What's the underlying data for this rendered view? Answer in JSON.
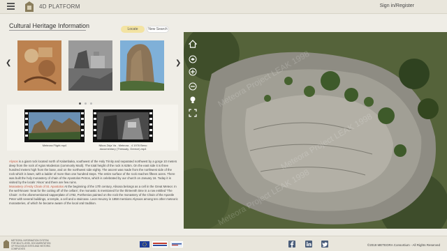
{
  "header": {
    "brand": "4D PLATFORM",
    "signin": "Sign in/Register"
  },
  "panel": {
    "title": "Cultural Heritage Information",
    "locate_label": "Locate",
    "new_search_label": "New Search"
  },
  "videos": [
    {
      "caption": "Meteora Flight.mp4"
    },
    {
      "caption": "Nikos Zeja Va - Meteora - 4 1976 Beno documentary (Thessaly, Greece).mp4"
    }
  ],
  "description": {
    "p1_name": "Alysos",
    "p1_text": " is a giant rock located north of Kalambaka, southwest of the Holy Trinity and separated northwest by a gorge 10 meters deep from the rock of Agios Modestos (commonly Modi). The total height of the rock is 625m. On the east side it is three hundred meters high from the base, and on the northwest side eighty. The ascent was made from the northwest side of the rock which is lower, with a ladder of more than one hundred steps. The entire surface of the rock reaches fifteen acres. There was built the holy monastery of chain of the Apostolos Petros, which is celebrated by our church on January 16. Today it is visited by the locals 'Alsos' and there are few ruins.",
    "p2_name": "Monastery of Holy Chain of St. Apostolos",
    "p2_text": " At the beginning of the 17th century, Alisosa belongs as a cell in the Great Meteor. In the well-known 'Seat for the cutting off of the cellars', the monastic is mentioned for the thirteenth time in a row entitled 'The Chain'. In the aforementioned sapperplate of 1782, Porthenios painted on the rock the monastery of the Chain of the Apostle Peter with several buildings, a temple, a cell and a staircase. Leon Heuzey in 1858 mentions Alysoos among ten other meteoric monasteries, of which he became aware of the local oral tradition."
  },
  "map": {
    "watermark": "Meteora Project LEAK 1998"
  },
  "footer": {
    "project_text": "METEORA. INFORMATION SYSTEM FOR MULTI-LEVEL DOCUMENTATION OF RELIGIOUS SITES AND HISTORIC COMPLEXES",
    "copyright": "©2019 METEORA Consortium - All Rights Reserved"
  },
  "colors": {
    "accent_locate": "#f3e3a2",
    "highlight": "#c2553f",
    "header_bg": "#e9e6dc"
  },
  "icons": {
    "menu": "hamburger-icon",
    "map_controls": [
      "home-icon",
      "layers-icon",
      "zoom-in-icon",
      "zoom-out-icon",
      "light-icon",
      "fullscreen-icon"
    ],
    "social": [
      "facebook-icon",
      "linkedin-icon",
      "twitter-icon"
    ]
  }
}
